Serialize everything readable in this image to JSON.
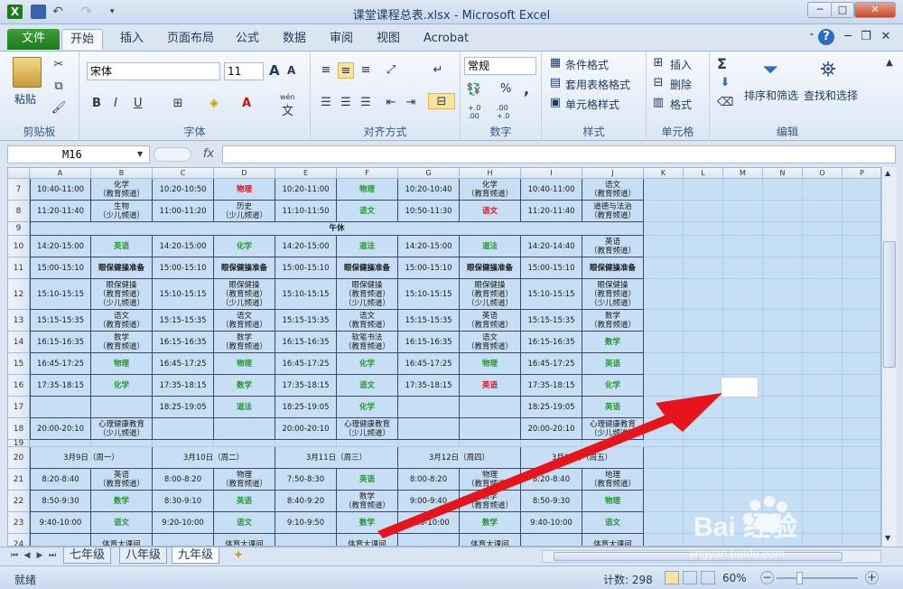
{
  "window": {
    "title": "课堂课程总表.xlsx - Microsoft Excel",
    "controls": [
      "─",
      "□",
      "✕"
    ]
  },
  "tabs": [
    "文件",
    "开始",
    "插入",
    "页面布局",
    "公式",
    "数据",
    "审阅",
    "视图",
    "Acrobat"
  ],
  "ribbon": {
    "clipboard": {
      "paste": "粘贴",
      "label": "剪贴板"
    },
    "font": {
      "name": "宋体",
      "size": "11",
      "label": "字体",
      "grow": "A",
      "shrink": "A",
      "bold": "B",
      "italic": "I",
      "underline": "U",
      "phonetic": "wén",
      "char": "文"
    },
    "alignment": {
      "label": "对齐方式"
    },
    "number": {
      "format": "常规",
      "label": "数字",
      "percent": "%",
      "comma": ",",
      "inc": "+.0\n.00",
      "dec": ".00\n+.0"
    },
    "styles": {
      "cond": "条件格式",
      "table": "套用表格格式",
      "cell": "单元格样式",
      "label": "样式"
    },
    "cells": {
      "insert": "插入",
      "delete": "删除",
      "format": "格式",
      "label": "单元格"
    },
    "editing": {
      "sort": "排序和筛选",
      "find": "查找和选择",
      "label": "编辑",
      "sigma": "Σ"
    }
  },
  "formula_bar": {
    "name_box": "M16",
    "fx": "fx",
    "value": ""
  },
  "columns": [
    "A",
    "B",
    "C",
    "D",
    "E",
    "F",
    "G",
    "H",
    "I",
    "J",
    "K",
    "L",
    "M",
    "N",
    "O",
    "P"
  ],
  "rows": [
    {
      "n": "7",
      "cells": [
        "10:40-11:00",
        "化学\n（教育频道）",
        "10:20-10:50",
        "物理",
        "10:20-11:00",
        "物理",
        "10:20-10:40",
        "化学\n（教育频道）",
        "10:40-11:00",
        "语文\n（教育频道）"
      ],
      "styles": [
        "",
        "",
        "",
        "r",
        "",
        "g",
        "",
        "",
        "",
        ""
      ]
    },
    {
      "n": "8",
      "cells": [
        "11:20-11:40",
        "生物\n（少儿频道）",
        "11:00-11:20",
        "历史\n（少儿频道）",
        "11:10-11:50",
        "语文",
        "10:50-11:30",
        "语文",
        "11:20-11:40",
        "道德与法治\n（教育频道）"
      ],
      "styles": [
        "",
        "",
        "",
        "",
        "",
        "g",
        "",
        "r",
        "",
        ""
      ]
    },
    {
      "n": "9",
      "merged": "午休"
    },
    {
      "n": "10",
      "cells": [
        "14:20-15:00",
        "英语",
        "14:20-15:00",
        "化学",
        "14:20-15:00",
        "道法",
        "14:20-15:00",
        "道法",
        "14:20-14:40",
        "英语\n（教育频道）"
      ],
      "styles": [
        "",
        "g",
        "",
        "g",
        "",
        "g",
        "",
        "g",
        "",
        ""
      ]
    },
    {
      "n": "11",
      "cells": [
        "15:00-15:10",
        "眼保健操准备",
        "15:00-15:10",
        "眼保健操准备",
        "15:00-15:10",
        "眼保健操准备",
        "15:00-15:10",
        "眼保健操准备",
        "15:00-15:10",
        "眼保健操准备"
      ],
      "styles": [
        "",
        "b",
        "",
        "b",
        "",
        "b",
        "",
        "b",
        "",
        "b"
      ]
    },
    {
      "n": "12",
      "cells": [
        "15:10-15:15",
        "眼保健操\n（教育频道）\n（少儿频道）",
        "15:10-15:15",
        "眼保健操\n（教育频道）\n（少儿频道）",
        "15:10-15:15",
        "眼保健操\n（教育频道）\n（少儿频道）",
        "15:10-15:15",
        "眼保健操\n（教育频道）\n（少儿频道）",
        "15:10-15:15",
        "眼保健操\n（教育频道）\n（少儿频道）"
      ],
      "styles": [
        "",
        "",
        "",
        "",
        "",
        "",
        "",
        "",
        "",
        ""
      ]
    },
    {
      "n": "13",
      "cells": [
        "15:15-15:35",
        "语文\n（教育频道）",
        "15:15-15:35",
        "语文\n（教育频道）",
        "15:15-15:35",
        "语文\n（教育频道）",
        "15:15-15:35",
        "英语\n（教育频道）",
        "15:15-15:35",
        "数学\n（教育频道）"
      ],
      "styles": [
        "",
        "",
        "",
        "",
        "",
        "",
        "",
        "",
        "",
        ""
      ]
    },
    {
      "n": "14",
      "cells": [
        "16:15-16:35",
        "数学\n（教育频道）",
        "16:15-16:35",
        "数学\n（教育频道）",
        "16:15-16:35",
        "软笔书法\n（教育频道）",
        "16:15-16:35",
        "语文\n（教育频道）",
        "16:15-16:35",
        "数学"
      ],
      "styles": [
        "",
        "",
        "",
        "",
        "",
        "",
        "",
        "",
        "",
        "g"
      ]
    },
    {
      "n": "15",
      "cells": [
        "16:45-17:25",
        "物理",
        "16:45-17:25",
        "物理",
        "16:45-17:25",
        "化学",
        "16:45-17:25",
        "物理",
        "16:45-17:25",
        "英语"
      ],
      "styles": [
        "",
        "g",
        "",
        "g",
        "",
        "g",
        "",
        "g",
        "",
        "g"
      ]
    },
    {
      "n": "16",
      "cells": [
        "17:35-18:15",
        "化学",
        "17:35-18:15",
        "数学",
        "17:35-18:15",
        "语文",
        "17:35-18:15",
        "英语",
        "17:35-18:15",
        "化学"
      ],
      "styles": [
        "",
        "g",
        "",
        "g",
        "",
        "g",
        "",
        "r",
        "",
        "g"
      ]
    },
    {
      "n": "17",
      "cells": [
        "",
        "",
        "18:25-19:05",
        "道法",
        "18:25-19:05",
        "化学",
        "",
        "",
        "18:25-19:05",
        "英语"
      ],
      "styles": [
        "",
        "",
        "",
        "g",
        "",
        "g",
        "",
        "",
        "",
        "g"
      ]
    },
    {
      "n": "18",
      "cells": [
        "20:00-20:10",
        "心理健康教育\n（少儿频道）",
        "",
        "",
        "20:00-20:10",
        "心理健康教育\n（少儿频道）",
        "",
        "",
        "20:00-20:10",
        "心理健康教育\n（少儿频道）"
      ],
      "styles": [
        "",
        "",
        "",
        "",
        "",
        "",
        "",
        "",
        "",
        ""
      ]
    },
    {
      "n": "19",
      "blank": true
    },
    {
      "n": "20",
      "days": [
        "3月9日（周一）",
        "3月10日（周二）",
        "3月11日（周三）",
        "3月12日（周四）",
        "3月13日（周五）"
      ]
    },
    {
      "n": "21",
      "cells": [
        "8:20-8:40",
        "英语\n（教育频道）",
        "8:00-8:20",
        "物理\n（教育频道）",
        "7:50-8:30",
        "英语",
        "8:00-8:20",
        "物理\n（教育频道）",
        "8:20-8:40",
        "地理\n（教育频道）"
      ],
      "styles": [
        "",
        "",
        "",
        "",
        "",
        "g",
        "",
        "",
        "",
        ""
      ]
    },
    {
      "n": "22",
      "cells": [
        "8:50-9:30",
        "数学",
        "8:30-9:10",
        "英语",
        "8:40-9:20",
        "数学\n（教育频道）",
        "9:00-9:40",
        "数学\n（教育频道）",
        "8:50-9:30",
        "物理"
      ],
      "styles": [
        "",
        "g",
        "",
        "g",
        "",
        "",
        "",
        "",
        "",
        "g"
      ]
    },
    {
      "n": "23",
      "cells": [
        "9:40-10:00",
        "语文",
        "9:20-10:00",
        "语文",
        "9:10-9:50",
        "数学",
        "9:30-10:00",
        "数学",
        "9:40-10:00",
        "语文"
      ],
      "styles": [
        "",
        "g",
        "",
        "g",
        "",
        "g",
        "",
        "g",
        "",
        "g"
      ]
    },
    {
      "n": "24",
      "cells": [
        "",
        "体育大课间",
        "",
        "体育大课间",
        "",
        "体育大课间",
        "",
        "体育大课间",
        "",
        "体育大课间"
      ],
      "styles": [
        "",
        "",
        "",
        "",
        "",
        "",
        "",
        "",
        "",
        ""
      ]
    }
  ],
  "sheets": [
    "七年级",
    "八年级",
    "九年级"
  ],
  "active_sheet": "九年级",
  "status": {
    "ready": "就绪",
    "count": "计数: 298",
    "zoom": "60%"
  },
  "watermark": {
    "brand": "Bai  经验",
    "site": "jingyan.baidu.com"
  },
  "colors": {
    "cell_fill": "#c6dff4",
    "green_text": "#1f9a2a",
    "red_text": "#e0101a",
    "arrow": "#e8141c"
  }
}
